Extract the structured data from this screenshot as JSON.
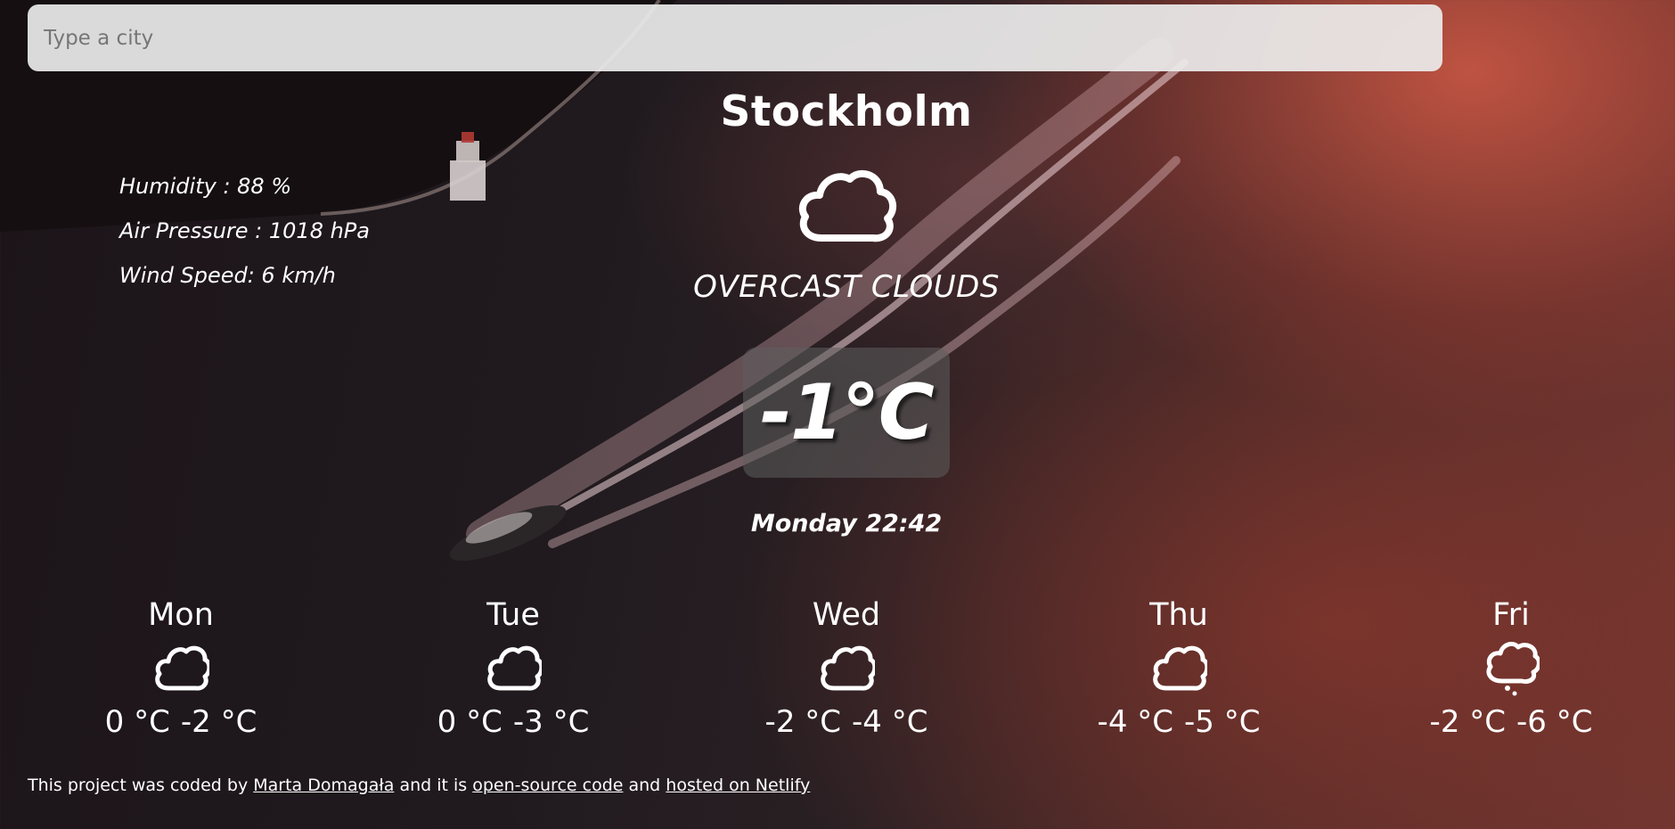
{
  "search": {
    "placeholder": "Type a city",
    "value": ""
  },
  "city": "Stockholm",
  "details": {
    "humidity": "Humidity : 88 %",
    "pressure": "Air Pressure : 1018 hPa",
    "wind": "Wind Speed: 6 km/h"
  },
  "current": {
    "icon": "cloud-icon",
    "description": "OVERCAST CLOUDS",
    "temperature": "-1°C",
    "datetime": "Monday 22:42"
  },
  "forecast": [
    {
      "day": "Mon",
      "icon": "cloud-icon",
      "max": "0 °C",
      "min": "-2 °C"
    },
    {
      "day": "Tue",
      "icon": "cloud-icon",
      "max": "0 °C",
      "min": "-3 °C"
    },
    {
      "day": "Wed",
      "icon": "cloud-icon",
      "max": "-2 °C",
      "min": "-4 °C"
    },
    {
      "day": "Thu",
      "icon": "cloud-icon",
      "max": "-4 °C",
      "min": "-5 °C"
    },
    {
      "day": "Fri",
      "icon": "snow-cloud-icon",
      "max": "-2 °C",
      "min": "-6 °C"
    }
  ],
  "footer": {
    "prefix": "This project was coded by",
    "author_link": "Marta Domagała",
    "middle": "and it is",
    "source_link": "open-source code",
    "and": "and",
    "hosting_link": "hosted on Netlify"
  }
}
